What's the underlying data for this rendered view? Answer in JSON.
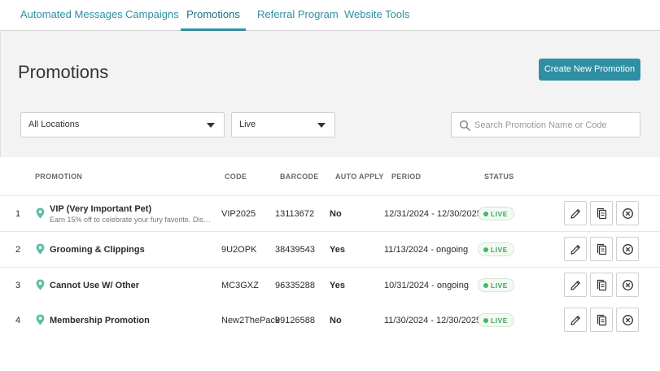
{
  "tabs": [
    {
      "label": "Automated Messages",
      "active": false
    },
    {
      "label": "Campaigns",
      "active": false
    },
    {
      "label": "Promotions",
      "active": true
    },
    {
      "label": "Referral Program",
      "active": false
    },
    {
      "label": "Website Tools",
      "active": false
    }
  ],
  "header": {
    "title": "Promotions",
    "create_button": "Create New Promotion"
  },
  "filters": {
    "location": "All Locations",
    "status": "Live",
    "search_placeholder": "Search Promotion Name or Code"
  },
  "table": {
    "columns": [
      "PROMOTION",
      "CODE",
      "BARCODE",
      "AUTO APPLY",
      "PERIOD",
      "STATUS"
    ],
    "rows": [
      {
        "num": "1",
        "name": "VIP (Very Important Pet)",
        "desc": "Earn 15% off to celebrate your fury favorite. Disco...",
        "code": "VIP2025",
        "barcode": "13113672",
        "auto_apply": "No",
        "period": "12/31/2024 - 12/30/2025",
        "status": "LIVE"
      },
      {
        "num": "2",
        "name": "Grooming & Clippings",
        "desc": "",
        "code": "9U2OPK",
        "barcode": "38439543",
        "auto_apply": "Yes",
        "period": "11/13/2024 - ongoing",
        "status": "LIVE"
      },
      {
        "num": "3",
        "name": "Cannot Use W/ Other",
        "desc": "",
        "code": "MC3GXZ",
        "barcode": "96335288",
        "auto_apply": "Yes",
        "period": "10/31/2024 - ongoing",
        "status": "LIVE"
      },
      {
        "num": "4",
        "name": "Membership Promotion",
        "desc": "",
        "code": "New2ThePack",
        "barcode": "99126588",
        "auto_apply": "No",
        "period": "11/30/2024 - 12/30/2025",
        "status": "LIVE"
      }
    ]
  },
  "icons": {
    "row_location": "map-pin-icon",
    "edit": "pencil-icon",
    "copy": "copy-icon",
    "delete": "close-circle-icon",
    "search": "search-icon"
  },
  "colors": {
    "accent": "#2f8fa3",
    "pin": "#5bbfa8",
    "live_dot": "#3fba5d",
    "live_text": "#3fa25a"
  }
}
